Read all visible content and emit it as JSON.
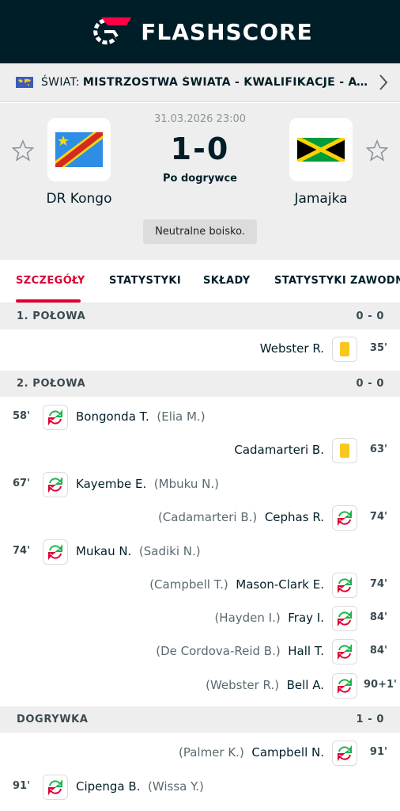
{
  "app": {
    "logo_text": "FLASHSCORE"
  },
  "breadcrumb": {
    "prefix": "ŚWIAT:",
    "title": "MISTRZOSTWA ŚWIATA - KWALIFIKACJE - AWA..."
  },
  "match": {
    "date": "31.03.2026 23:00",
    "score": "1-0",
    "status": "Po dogrywce",
    "venue_note": "Neutralne boisko.",
    "home": {
      "name": "DR Kongo"
    },
    "away": {
      "name": "Jamajka"
    }
  },
  "tabs": [
    {
      "label": "SZCZEGÓŁY",
      "active": true
    },
    {
      "label": "STATYSTYKI",
      "active": false
    },
    {
      "label": "SKŁADY",
      "active": false
    },
    {
      "label": "STATYSTYKI ZAWODNIKÓW",
      "active": false
    }
  ],
  "colors": {
    "brand_dark": "#001e28",
    "accent": "#dc0033",
    "yellow_card": "#f8c81c",
    "sub_green": "#1cb34a",
    "sub_red": "#dc0033"
  },
  "sections": [
    {
      "title": "1. POŁOWA",
      "score": "0 - 0"
    },
    {
      "title": "2. POŁOWA",
      "score": "0 - 0"
    },
    {
      "title": "DOGRYWKA",
      "score": "1 - 0"
    }
  ],
  "events": [
    {
      "side": "away",
      "type": "yellow-card",
      "minute": "35'",
      "player": "Webster R.",
      "assist": ""
    },
    {
      "side": "home",
      "type": "substitution",
      "minute": "58'",
      "player": "Bongonda T.",
      "assist": "(Elia M.)"
    },
    {
      "side": "away",
      "type": "yellow-card",
      "minute": "63'",
      "player": "Cadamarteri B.",
      "assist": ""
    },
    {
      "side": "home",
      "type": "substitution",
      "minute": "67'",
      "player": "Kayembe E.",
      "assist": "(Mbuku N.)"
    },
    {
      "side": "away",
      "type": "substitution",
      "minute": "74'",
      "player": "Cephas R.",
      "assist": "(Cadamarteri B.)"
    },
    {
      "side": "home",
      "type": "substitution",
      "minute": "74'",
      "player": "Mukau N.",
      "assist": "(Sadiki N.)"
    },
    {
      "side": "away",
      "type": "substitution",
      "minute": "74'",
      "player": "Mason-Clark E.",
      "assist": "(Campbell T.)"
    },
    {
      "side": "away",
      "type": "substitution",
      "minute": "84'",
      "player": "Fray I.",
      "assist": "(Hayden I.)"
    },
    {
      "side": "away",
      "type": "substitution",
      "minute": "84'",
      "player": "Hall T.",
      "assist": "(De Cordova-Reid B.)"
    },
    {
      "side": "away",
      "type": "substitution",
      "minute": "90+1'",
      "player": "Bell A.",
      "assist": "(Webster R.)"
    },
    {
      "side": "away",
      "type": "substitution",
      "minute": "91'",
      "player": "Campbell N.",
      "assist": "(Palmer K.)"
    },
    {
      "side": "home",
      "type": "substitution",
      "minute": "91'",
      "player": "Cipenga B.",
      "assist": "(Wissa Y.)"
    }
  ]
}
